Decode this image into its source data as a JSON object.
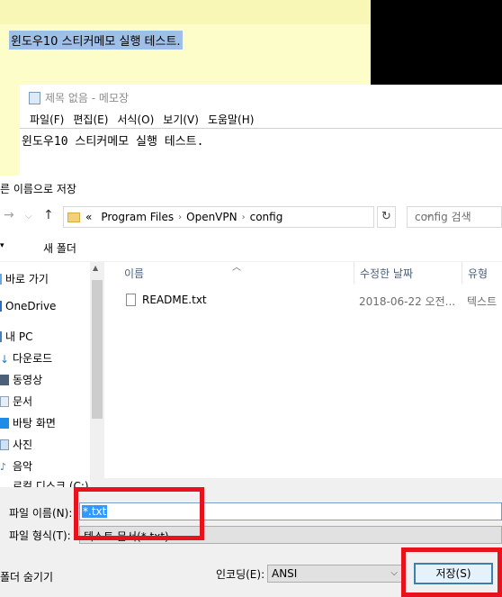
{
  "sticky": {
    "text": "윈도우10 스티커메모 실행 테스트."
  },
  "notepad": {
    "title": "제목 없음 - 메모장",
    "menu": [
      "파일(F)",
      "편집(E)",
      "서식(O)",
      "보기(V)",
      "도움말(H)"
    ],
    "content": "윈도우10 스티커메모 실행 테스트."
  },
  "dialog": {
    "title": "른 이름으로 저장",
    "breadcrumb": {
      "prefix": "«",
      "items": [
        "Program Files",
        "OpenVPN",
        "config"
      ]
    },
    "search_placeholder": "config 검색",
    "toolbar": {
      "new_folder": "새 폴더"
    },
    "nav": [
      "바로 가기",
      "OneDrive",
      "내 PC",
      "다운로드",
      "동영상",
      "문서",
      "바탕 화면",
      "사진",
      "음악",
      "로컬 디스크 (C:)"
    ],
    "columns": [
      "이름",
      "수정한 날짜",
      "유형"
    ],
    "files": [
      {
        "name": "README.txt",
        "date": "2018-06-22 오전...",
        "type": "텍스트"
      }
    ],
    "filename_label": "파일 이름(N):",
    "filename_value": "*.txt",
    "filetype_label": "파일 형식(T):",
    "filetype_value": "텍스트 문서(*.txt)",
    "hide_folders": "폴더 숨기기",
    "encoding_label": "인코딩(E):",
    "encoding_value": "ANSI",
    "save_button": "저장(S)"
  },
  "colors": {
    "highlight": "#e8121d",
    "selection": "#3399ff",
    "sticky": "#fdfdca"
  }
}
